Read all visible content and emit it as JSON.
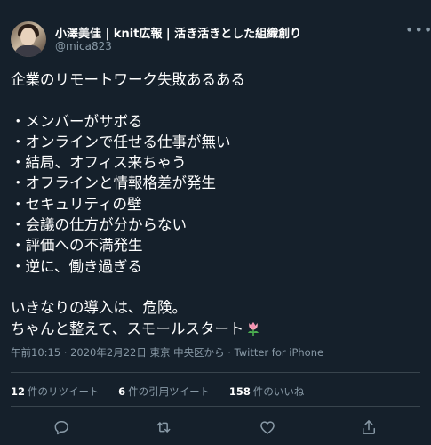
{
  "author": {
    "display_name": "小澤美佳 | knit広報 | 活き活きとした組織創り",
    "handle": "@mica823"
  },
  "more_icon": "more-horizontal-icon",
  "tweet": {
    "lines": [
      "企業のリモートワーク失敗あるある",
      "",
      "・メンバーがサボる",
      "・オンラインで任せる仕事が無い",
      "・結局、オフィス来ちゃう",
      "・オフラインと情報格差が発生",
      "・セキュリティの壁",
      "・会議の仕方が分からない",
      "・評価への不満発生",
      "・逆に、働き過ぎる",
      "",
      "いきなりの導入は、危険。",
      "ちゃんと整えて、スモールスタート"
    ],
    "emoji": "tulip"
  },
  "meta": "午前10:15 · 2020年2月22日 東京 中央区から · Twitter for iPhone",
  "stats": [
    {
      "count": "12",
      "label": "件のリツイート"
    },
    {
      "count": "6",
      "label": "件の引用ツイート"
    },
    {
      "count": "158",
      "label": "件のいいね"
    }
  ],
  "actions": [
    "reply-icon",
    "retweet-icon",
    "like-icon",
    "share-icon"
  ],
  "colors": {
    "background": "#15202b",
    "text": "#ffffff",
    "secondary": "#8899a6",
    "divider": "#38444d"
  }
}
